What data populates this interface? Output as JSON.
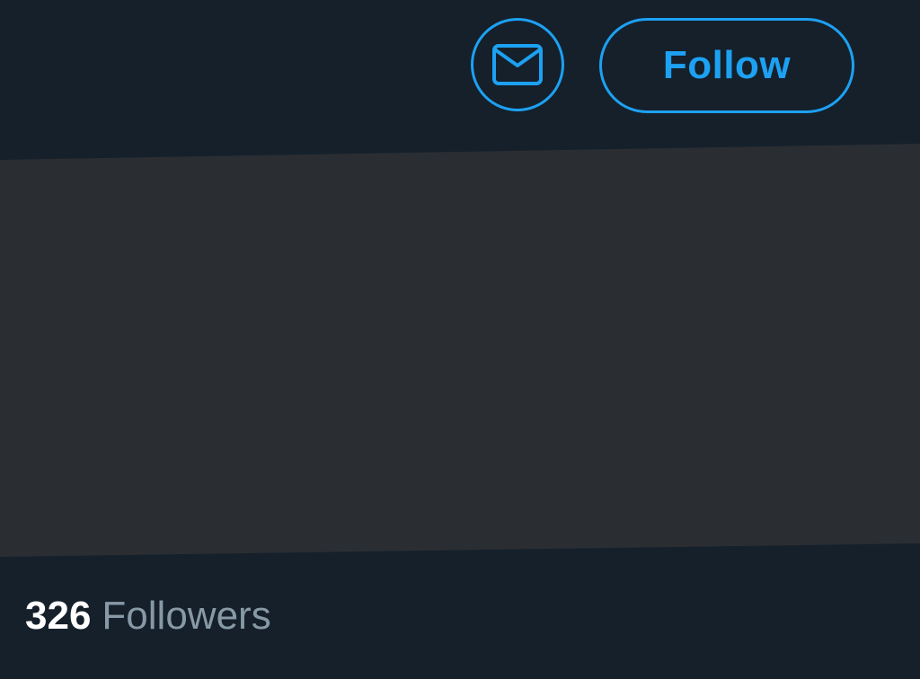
{
  "colors": {
    "background": "#15202b",
    "accent": "#1da1f2",
    "panel": "#2a2e33",
    "primary_text": "#ffffff",
    "secondary_text": "#8899a6"
  },
  "header": {
    "message_icon": "envelope-icon",
    "follow_label": "Follow"
  },
  "stats": {
    "followers_count": "326",
    "followers_label": "Followers"
  }
}
